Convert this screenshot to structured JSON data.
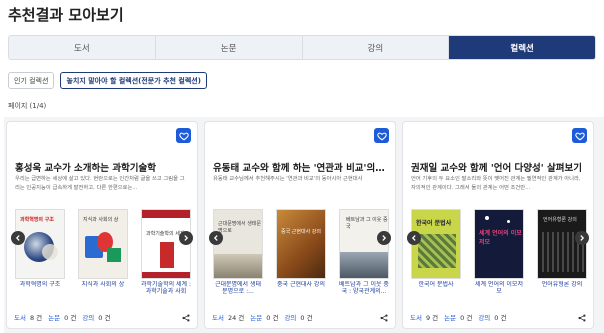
{
  "page": {
    "title": "추천결과 모아보기",
    "page_indicator": "페이지 (1/4)"
  },
  "tabs": [
    {
      "label": "도서",
      "active": false
    },
    {
      "label": "논문",
      "active": false
    },
    {
      "label": "강의",
      "active": false
    },
    {
      "label": "컬렉션",
      "active": true
    }
  ],
  "subtabs": [
    {
      "label": "인기 컬렉션",
      "active": false
    },
    {
      "label": "놓치지 말아야 할 컬렉션(전문가 추천 컬렉션)",
      "active": true
    }
  ],
  "colors": {
    "accent": "#1e3a78",
    "heart": "#1e5bd8",
    "link": "#1a3a9a"
  },
  "cards": [
    {
      "title": "홍성욱 교수가 소개하는 과학기술학",
      "desc": "우리는 급변하는 세상에 살고 있다. 현란으로는 인간처럼 글을 쓰고 그림을 그리는 인공지능이 급속하게 발전하고, 다른 한편으로는...",
      "books": [
        {
          "title": "과학혁명의 구조",
          "cover": "과학혁명의 구조"
        },
        {
          "title": "지식과 사회의 상",
          "cover": "지식과 사회의 상"
        },
        {
          "title": "과학기술학의 세계 : 과학기술과 사회를...",
          "cover": "과학기술학의 세계"
        }
      ],
      "stats": {
        "book_label": "도서",
        "book_count": "8 건",
        "paper_label": "논문",
        "paper_count": "0 건",
        "lecture_label": "강의",
        "lecture_count": "0 건"
      }
    },
    {
      "title": "유동태 교수와 함께 하는 '연관과 비교'의 동아시아 근현대사",
      "desc": "유동태 교수님께서 추천해주시는 '연관과 비교'의 동아시아 근현대사",
      "books": [
        {
          "title": "근대문명에서 생태문명으로 :...",
          "cover": "근대문명에서 생태문명으로"
        },
        {
          "title": "중국 근현대사 강의",
          "cover": "중국 근현대사 강의"
        },
        {
          "title": "베트남과 그 이웃 중국 : 양국관계의...",
          "cover": "베트남과 그 이웃 중국"
        }
      ],
      "stats": {
        "book_label": "도서",
        "book_count": "24 건",
        "paper_label": "논문",
        "paper_count": "0 건",
        "lecture_label": "강의",
        "lecture_count": "0 건"
      }
    },
    {
      "title": "권재일 교수와 함께 '언어 다양성' 살펴보기",
      "desc": "언어 기후의 두 요소인 말소리와 뜻이 맺어진 관계는 필연적인 관계가 아니라, 자의적인 관계이다. 그래서 둘의 관계는 어떤 조건만...",
      "books": [
        {
          "title": "한국어 문법사",
          "cover": "한국어 문법사"
        },
        {
          "title": "세계 언어의 이모저모",
          "cover": "세계 언어의 이모저모"
        },
        {
          "title": "언어유형론 강의",
          "cover": "언어유형론 강의"
        }
      ],
      "stats": {
        "book_label": "도서",
        "book_count": "9 건",
        "paper_label": "논문",
        "paper_count": "0 건",
        "lecture_label": "강의",
        "lecture_count": "0 건"
      }
    }
  ]
}
